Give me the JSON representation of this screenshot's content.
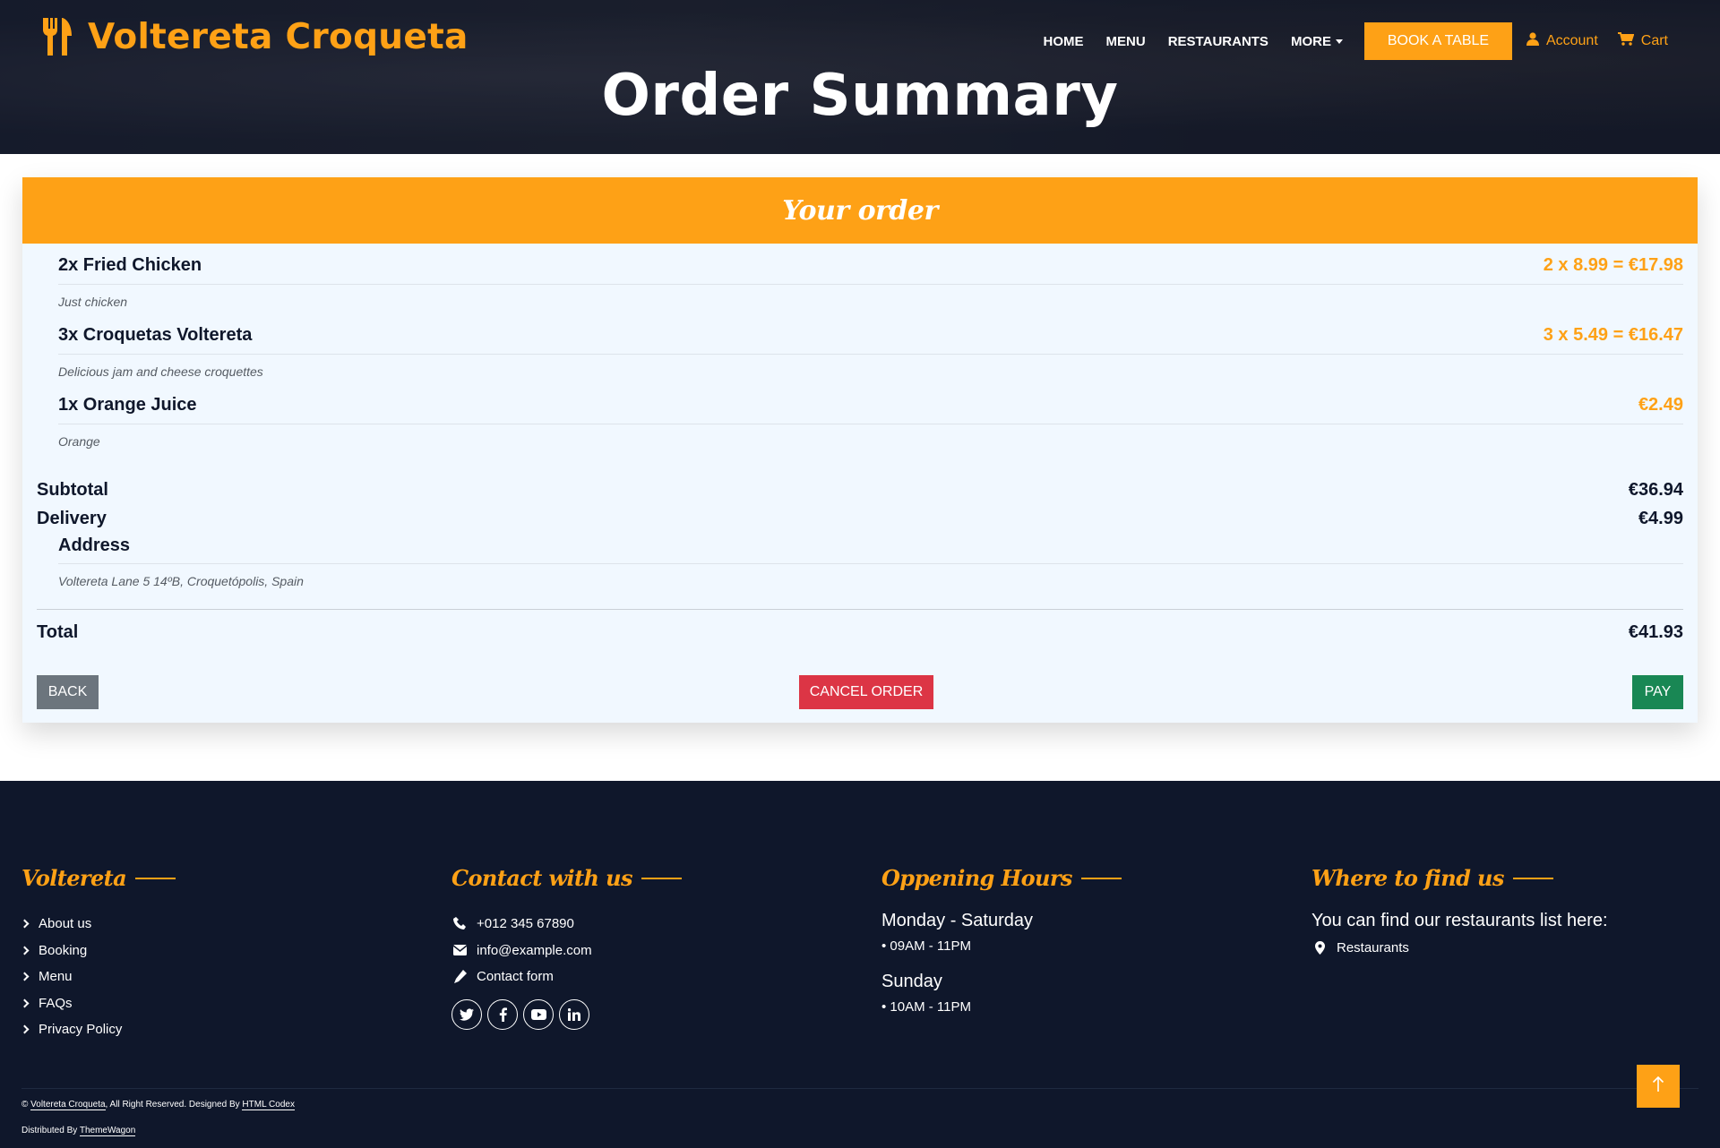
{
  "brand": {
    "name": "Voltereta Croqueta",
    "icon": "utensils-icon"
  },
  "nav": {
    "links": [
      "HOME",
      "MENU",
      "RESTAURANTS"
    ],
    "more": "MORE",
    "book": "BOOK A TABLE",
    "account": "Account",
    "cart": "Cart"
  },
  "page": {
    "title": "Order Summary"
  },
  "order": {
    "title": "Your order",
    "items": [
      {
        "name": "2x Fried Chicken",
        "price": "2 x 8.99 = €17.98",
        "desc": "Just chicken"
      },
      {
        "name": "3x Croquetas Voltereta",
        "price": "3 x 5.49 = €16.47",
        "desc": "Delicious jam and cheese croquettes"
      },
      {
        "name": "1x Orange Juice",
        "price": "€2.49",
        "desc": "Orange"
      }
    ],
    "subtotal_label": "Subtotal",
    "subtotal": "€36.94",
    "delivery_label": "Delivery",
    "delivery": "€4.99",
    "address_label": "Address",
    "address": "Voltereta Lane 5 14ºB, Croquetópolis, Spain",
    "total_label": "Total",
    "total": "€41.93",
    "buttons": {
      "back": "BACK",
      "cancel": "CANCEL ORDER",
      "pay": "PAY"
    }
  },
  "footer": {
    "col1": {
      "title": "Voltereta",
      "links": [
        "About us",
        "Booking",
        "Menu",
        "FAQs",
        "Privacy Policy"
      ]
    },
    "col2": {
      "title": "Contact with us",
      "phone": "+012 345 67890",
      "email": "info@example.com",
      "contact": "Contact form",
      "socials": [
        "twitter-icon",
        "facebook-icon",
        "youtube-icon",
        "linkedin-icon"
      ]
    },
    "col3": {
      "title": "Oppening Hours",
      "day1": "Monday - Saturday",
      "time1": "• 09AM - 11PM",
      "day2": "Sunday",
      "time2": "• 10AM - 11PM"
    },
    "col4": {
      "title": "Where to find us",
      "text": "You can find our restaurants list here:",
      "link": "Restaurants"
    },
    "copyright": {
      "prefix": "©",
      "site": "Voltereta Croqueta",
      "middle": ", All Right Reserved. Designed By",
      "designer": "HTML Codex",
      "distributed": "Distributed By",
      "distributor": "ThemeWagon"
    }
  },
  "colors": {
    "accent": "#fea116",
    "dark": "#0f172b",
    "danger": "#dc3545",
    "success": "#198754",
    "secondary": "#6c757d"
  }
}
